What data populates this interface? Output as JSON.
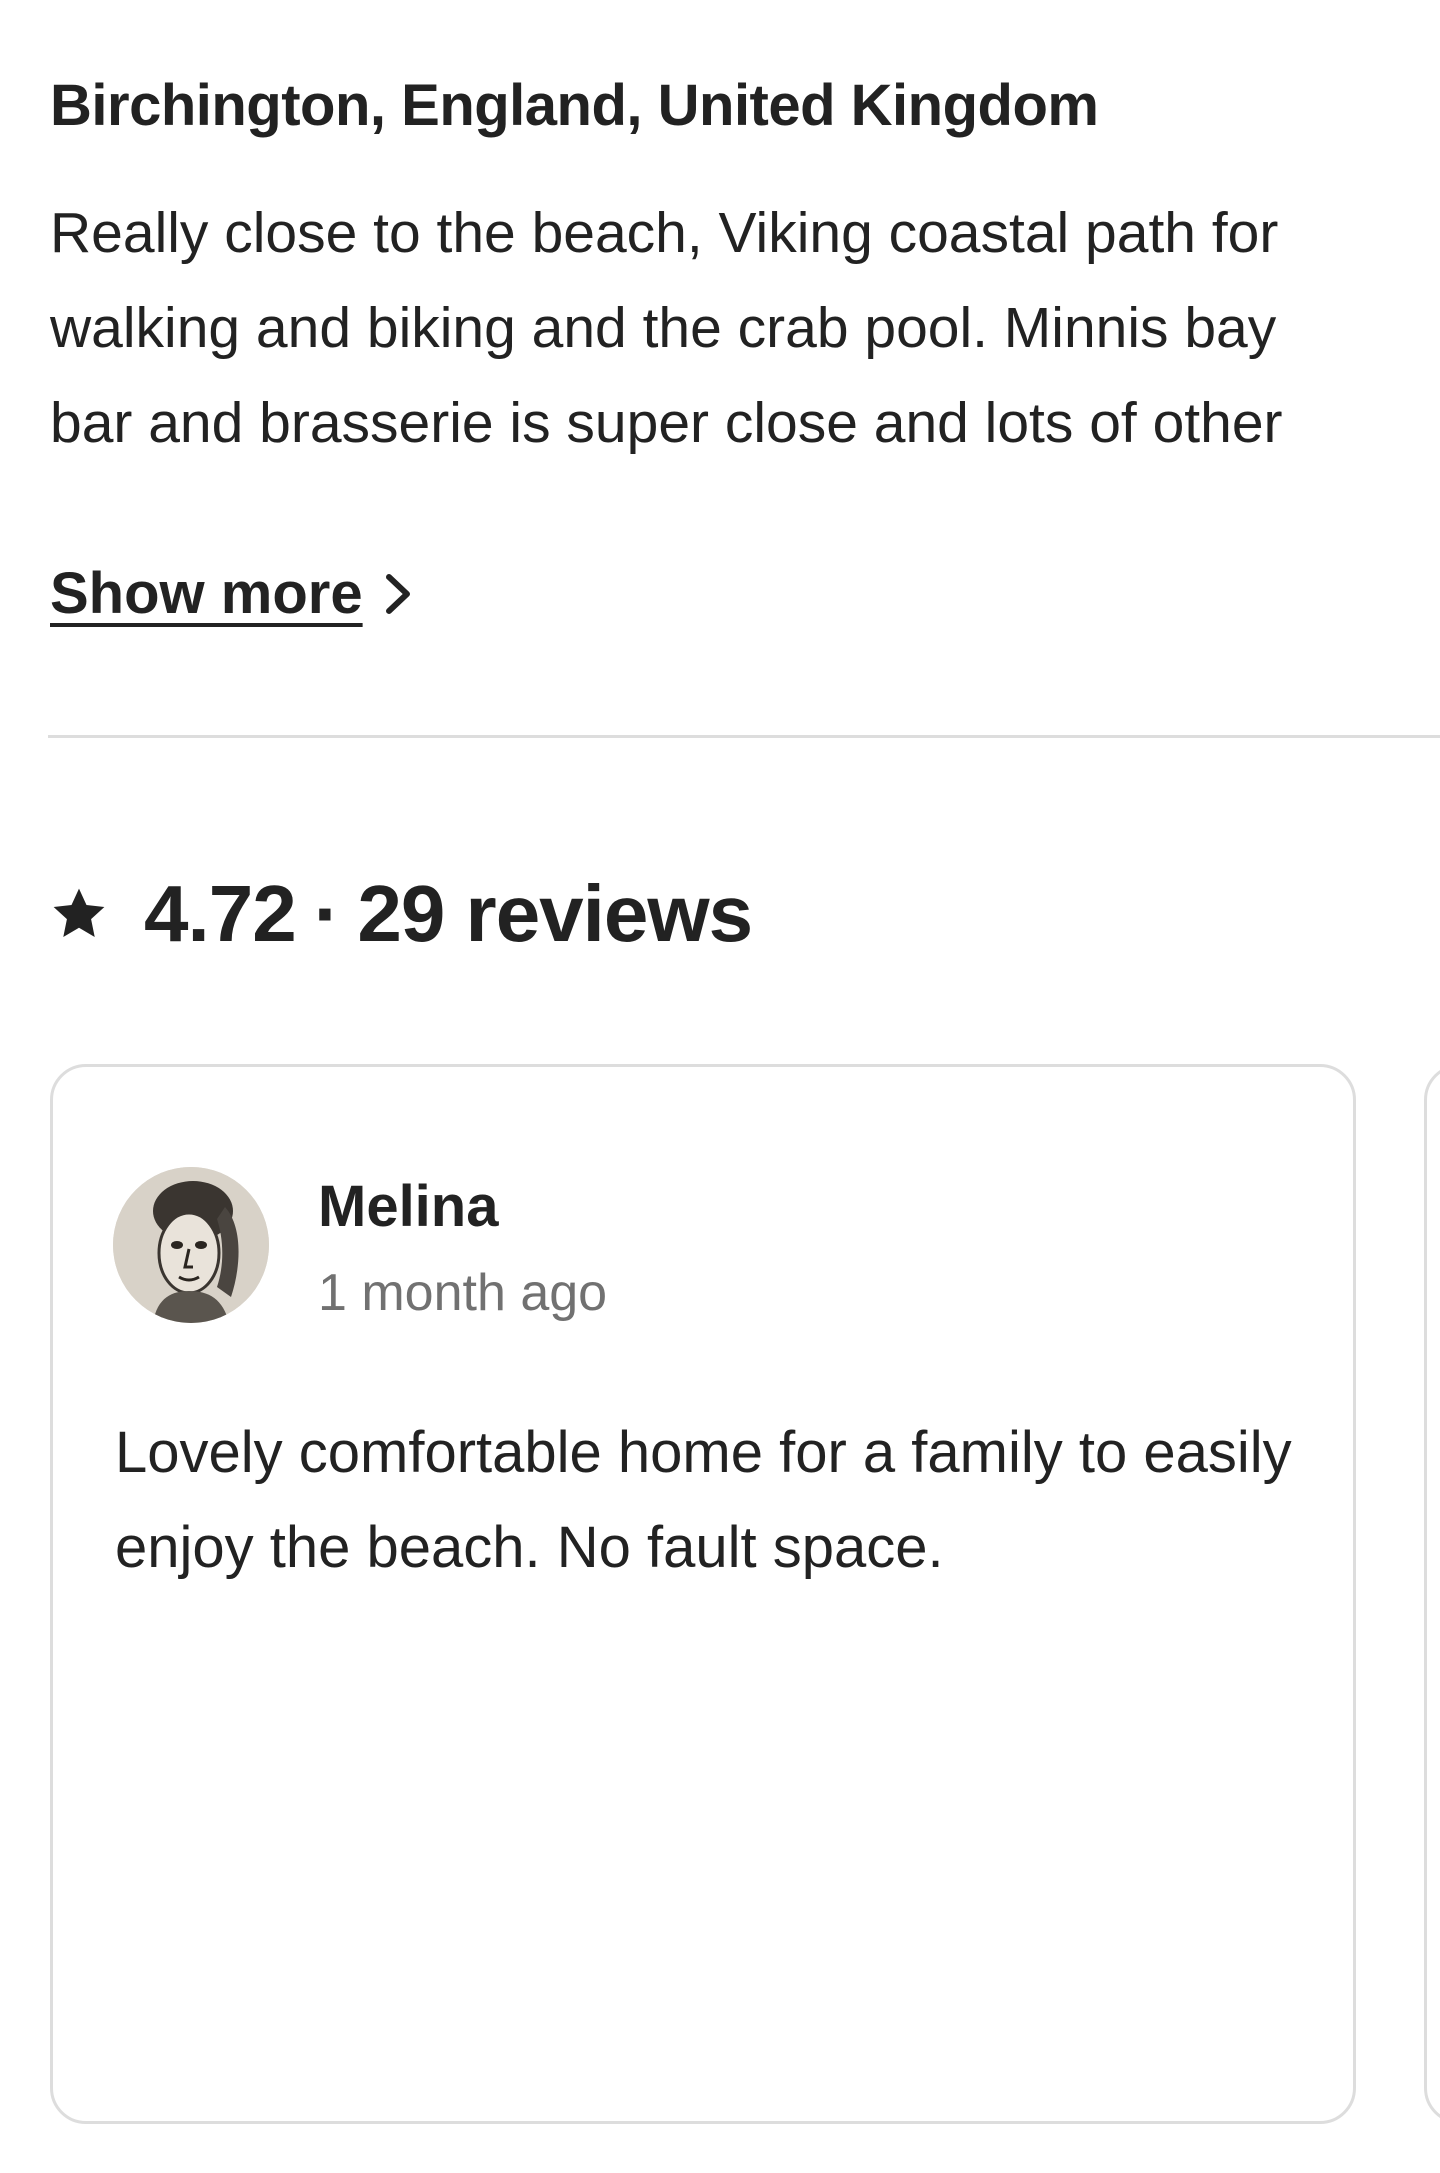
{
  "location": {
    "title": "Birchington, England, United Kingdom",
    "description_lines": [
      "Really close to the beach, Viking coastal path for",
      "walking and biking and the crab pool. Minnis bay",
      "bar and brasserie is super close and lots of other"
    ],
    "show_more_label": "Show more"
  },
  "reviews_summary": {
    "rating": "4.72",
    "separator": "·",
    "count_label": "29 reviews",
    "star_icon": "star-icon"
  },
  "reviews": [
    {
      "name": "Melina",
      "date": "1 month ago",
      "text": "Lovely comfortable home for a family to easily enjoy the beach. No fault space.",
      "avatar_icon": "avatar-portrait"
    }
  ],
  "colors": {
    "text": "#222222",
    "secondary_text": "#717171",
    "divider": "#dddddd"
  }
}
